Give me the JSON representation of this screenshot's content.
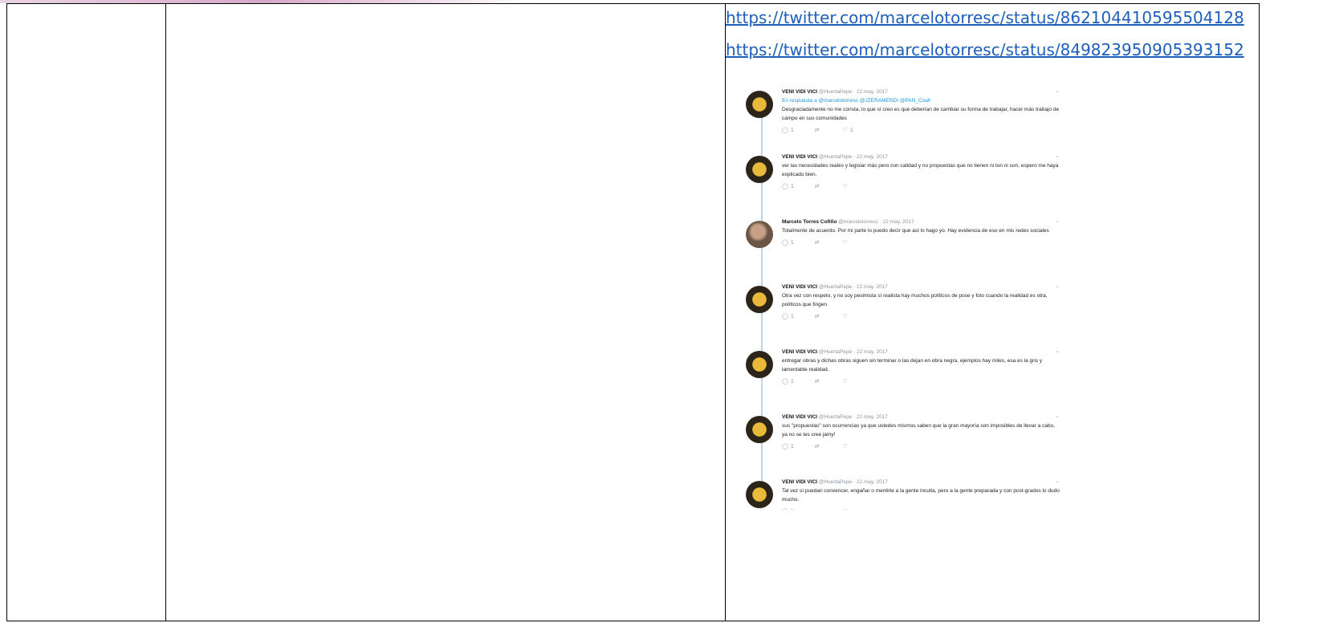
{
  "links": [
    "https://twitter.com/marcelotorresc/status/862104410595504128",
    "https://twitter.com/marcelotorresc/status/849823950905393152"
  ],
  "tweets": [
    {
      "name": "VENI VIDI VICI",
      "handle": "@HuertaPepe",
      "date": "22 may. 2017",
      "reply": "En respuesta a @marcelotorresc @JZERAMENDI @PAN_Coah",
      "text": "Desgraciadamente no me consta, lo que sí creo es que deberían de cambiar su forma de trabajar, hacer más trabajo de campo en sus comunidades",
      "replies": "1",
      "retweets": "",
      "likes": "1",
      "avatar": "lion"
    },
    {
      "name": "VENI VIDI VICI",
      "handle": "@HuertaPepe",
      "date": "22 may. 2017",
      "reply": "",
      "text": "ver las necesidades reales y legislar más pero con calidad y no propuestas que no tienen ni ton ni son, espero me haya explicado bien.",
      "replies": "1",
      "retweets": "",
      "likes": "",
      "avatar": "lion"
    },
    {
      "name": "Marcelo Torres Cofiño",
      "handle": "@marcelotorresc",
      "date": "22 may. 2017",
      "reply": "",
      "text": "Totalmente de acuerdo. Por mi parte lo puedo decir que así lo hago yo. Hay evidencia de eso en mis redes sociales",
      "replies": "1",
      "retweets": "",
      "likes": "",
      "avatar": "person"
    },
    {
      "name": "VENI VIDI VICI",
      "handle": "@HuertaPepe",
      "date": "22 may. 2017",
      "reply": "",
      "text": "Otra vez con respeto, y no soy pesimista sí realista hay muchos políticos de pose y foto cuando la realidad es otra, políticos que fingen",
      "replies": "1",
      "retweets": "",
      "likes": "",
      "avatar": "lion"
    },
    {
      "name": "VENI VIDI VICI",
      "handle": "@HuertaPepe",
      "date": "22 may. 2017",
      "reply": "",
      "text": "entregar obras y dichas obras siguen sin terminar o las dejan en obra negra, ejemplos hay miles, esa es la gris y lamentable realidad.",
      "replies": "1",
      "retweets": "",
      "likes": "",
      "avatar": "lion"
    },
    {
      "name": "VENI VIDI VICI",
      "handle": "@HuertaPepe",
      "date": "22 may. 2017",
      "reply": "",
      "text": "sus \"propuestas\" son ocurrencias ya que ustedes mismos saben que la gran mayoría son imposibles de llevar a cabo, ya no se les cree jamy!",
      "replies": "1",
      "retweets": "",
      "likes": "",
      "avatar": "lion"
    },
    {
      "name": "VENI VIDI VICI",
      "handle": "@HuertaPepe",
      "date": "22 may. 2017",
      "reply": "",
      "text": "Tal vez sí puedan convencer, engañar o mentirle a la gente inculta, pero a la gente preparada y con post-grados lo dudo mucho.",
      "replies": "1",
      "retweets": "",
      "likes": "",
      "avatar": "lion"
    }
  ]
}
